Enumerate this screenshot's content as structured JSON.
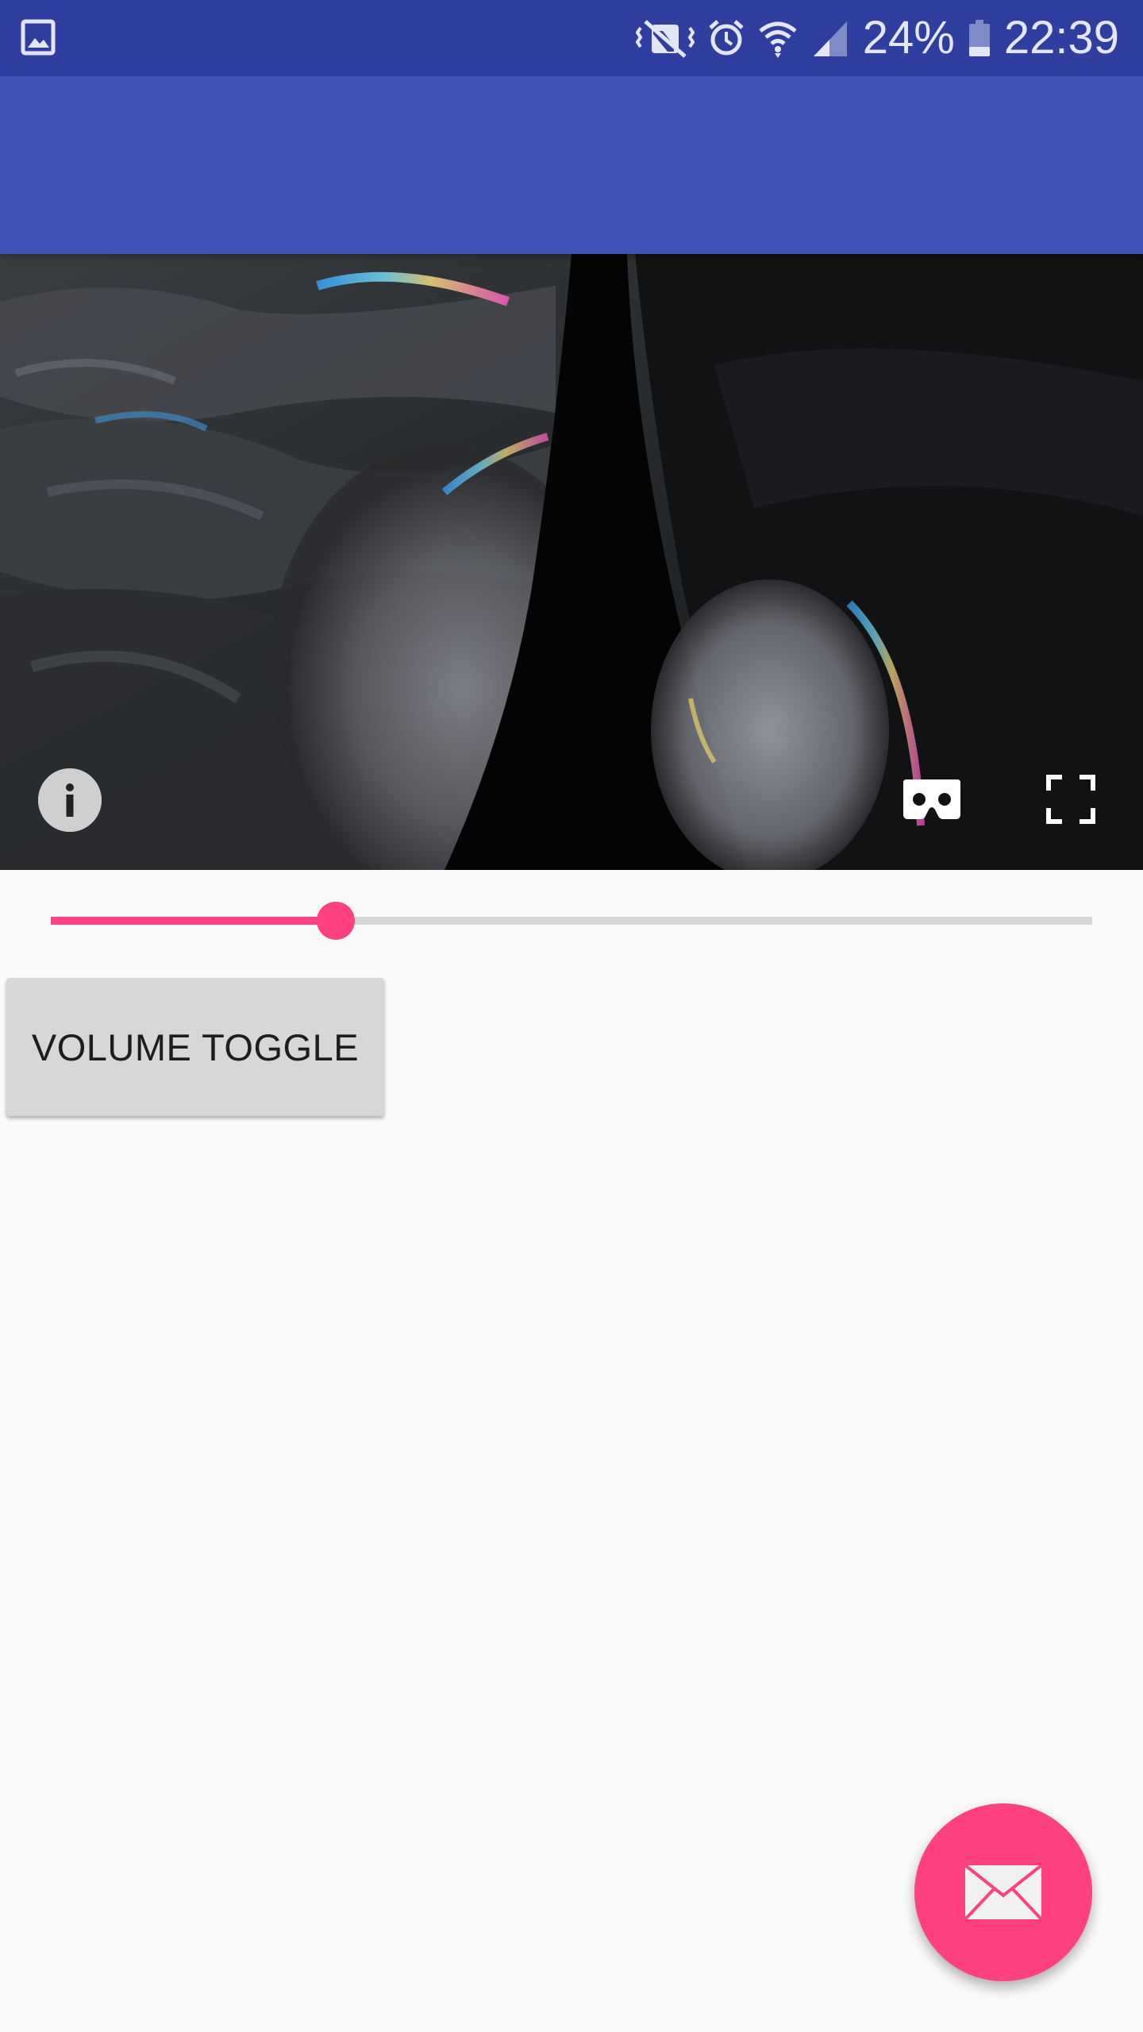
{
  "status_bar": {
    "battery_percent": "24%",
    "time": "22:39",
    "icons": [
      "gallery-notification-icon",
      "vibrate-icon",
      "alarm-icon",
      "wifi-icon",
      "signal-icon",
      "battery-icon"
    ]
  },
  "video": {
    "icons": [
      "info-icon",
      "cardboard-icon",
      "fullscreen-icon"
    ],
    "progress_fraction": 0.274
  },
  "controls": {
    "volume_toggle_label": "VOLUME TOGGLE"
  },
  "fab": {
    "icon": "email-icon"
  },
  "colors": {
    "status_bar": "#303f9f",
    "app_bar": "#3f51b5",
    "accent": "#ff4081",
    "background": "#fafafa",
    "button": "#d6d7d7"
  }
}
